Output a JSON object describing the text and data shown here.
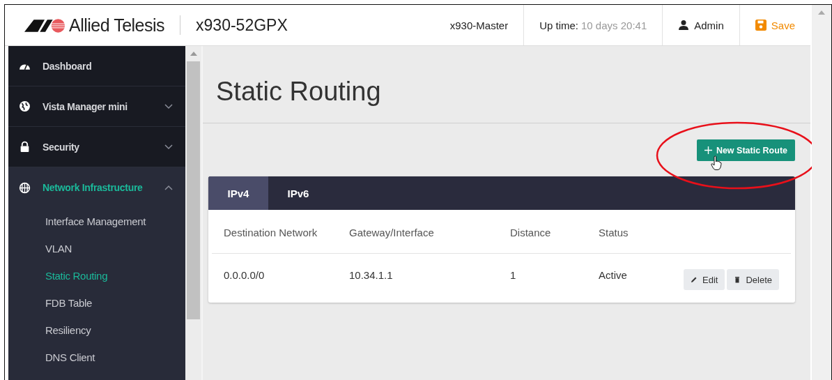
{
  "header": {
    "brand": "Allied Telesis",
    "model": "x930-52GPX",
    "host": "x930-Master",
    "uptime_label": "Up time:",
    "uptime_value": "10 days 20:41",
    "user": "Admin",
    "save": "Save"
  },
  "sidebar": {
    "items": [
      {
        "label": "Dashboard",
        "kind": "link",
        "selected": false
      },
      {
        "label": "Vista Manager mini",
        "kind": "group",
        "selected": false,
        "expanded": false
      },
      {
        "label": "Security",
        "kind": "group",
        "selected": false,
        "expanded": false
      },
      {
        "label": "Network Infrastructure",
        "kind": "group",
        "selected": true,
        "expanded": true,
        "children": [
          {
            "label": "Interface Management",
            "selected": false
          },
          {
            "label": "VLAN",
            "selected": false
          },
          {
            "label": "Static Routing",
            "selected": true
          },
          {
            "label": "FDB Table",
            "selected": false
          },
          {
            "label": "Resiliency",
            "selected": false
          },
          {
            "label": "DNS Client",
            "selected": false
          }
        ]
      }
    ]
  },
  "page": {
    "title": "Static Routing",
    "new_button": "New Static Route"
  },
  "tabs": [
    {
      "label": "IPv4",
      "selected": true
    },
    {
      "label": "IPv6",
      "selected": false
    }
  ],
  "table": {
    "columns": [
      "Destination Network",
      "Gateway/Interface",
      "Distance",
      "Status"
    ],
    "rows": [
      {
        "cells": [
          "0.0.0.0/0",
          "10.34.1.1",
          "1",
          "Active"
        ],
        "actions": [
          "Edit",
          "Delete"
        ]
      }
    ]
  }
}
